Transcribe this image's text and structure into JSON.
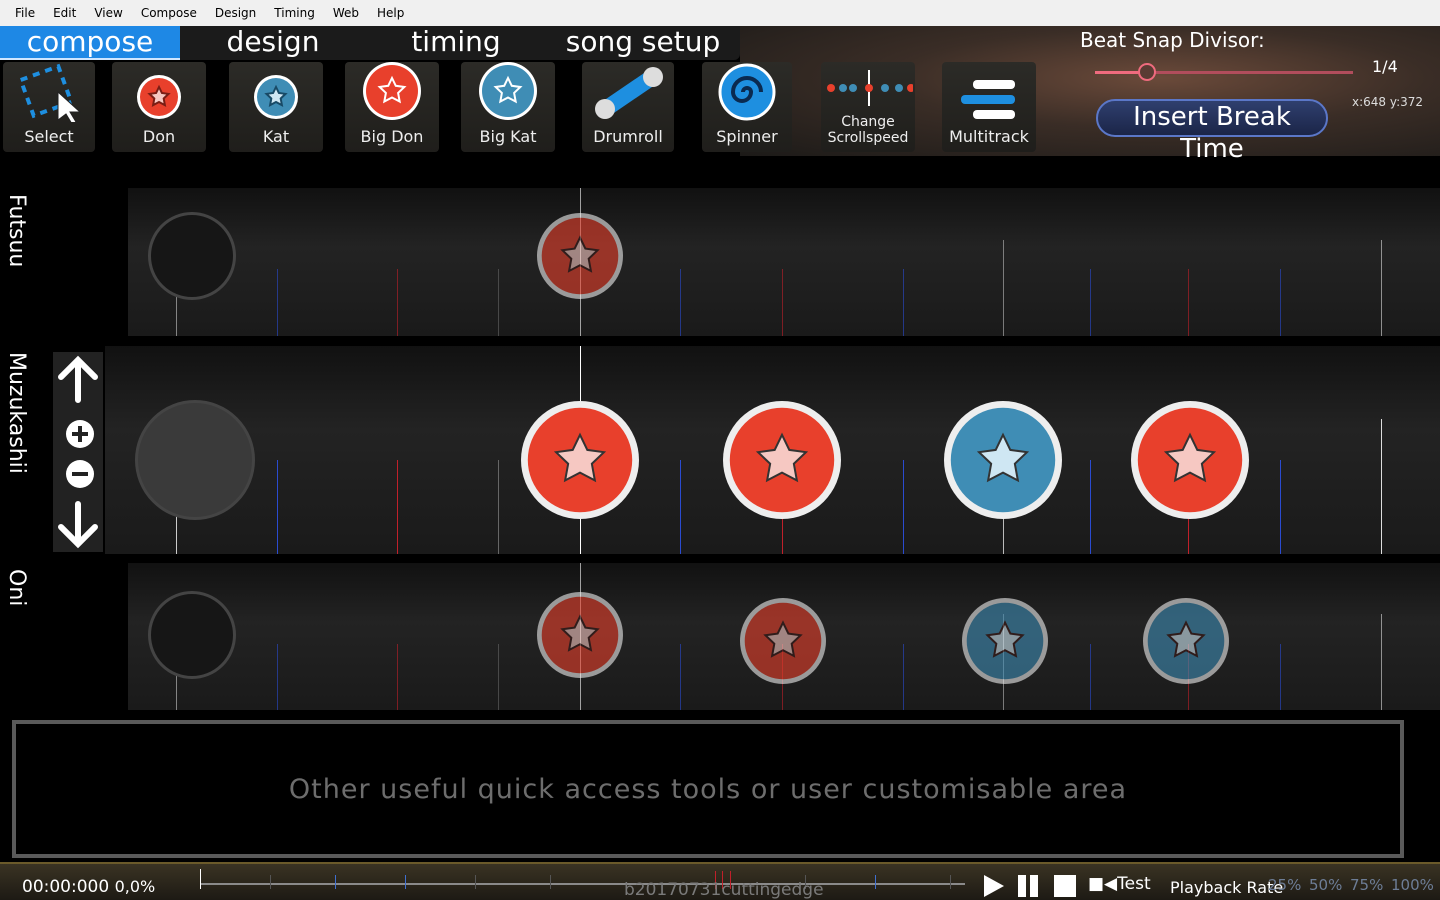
{
  "menu": [
    "File",
    "Edit",
    "View",
    "Compose",
    "Design",
    "Timing",
    "Web",
    "Help"
  ],
  "tabs": [
    {
      "label": "compose",
      "active": true
    },
    {
      "label": "design"
    },
    {
      "label": "timing"
    },
    {
      "label": "song setup"
    }
  ],
  "tools": [
    {
      "label": "Select",
      "icon": "select-icon"
    },
    {
      "label": "Don",
      "icon": "don-icon"
    },
    {
      "label": "Kat",
      "icon": "kat-icon"
    },
    {
      "label": "Big Don",
      "icon": "big-don-icon"
    },
    {
      "label": "Big Kat",
      "icon": "big-kat-icon"
    },
    {
      "label": "Drumroll",
      "icon": "drumroll-icon"
    },
    {
      "label": "Spinner",
      "icon": "spinner-icon"
    },
    {
      "label": "Change Scrollspeed",
      "icon": "scrollspeed-icon"
    },
    {
      "label": "Multitrack",
      "icon": "multitrack-icon"
    }
  ],
  "snap": {
    "label": "Beat Snap Divisor:",
    "value": "1/4",
    "level": 0.2
  },
  "coords": "x:648 y:372",
  "break_button": "Insert Break Time",
  "lanes": [
    {
      "label": "Futsuu",
      "notes": [
        "don"
      ]
    },
    {
      "label": "Muzukashii",
      "notes": [
        "don",
        "don",
        "kat",
        "don"
      ]
    },
    {
      "label": "Oni",
      "notes": [
        "don",
        "don",
        "kat",
        "kat"
      ]
    }
  ],
  "bottom_panel": "Other useful quick access tools or user customisable area",
  "timeline": {
    "time": "00:00:000",
    "percent": "0,0%",
    "version": "b20170731cuttingedge",
    "test": "Test",
    "playback_label": "Playback Rate",
    "rates": [
      "25%",
      "50%",
      "75%",
      "100%"
    ]
  },
  "colors": {
    "don": "#e8402c",
    "kat": "#3f8db5",
    "accent": "#1e88e5"
  }
}
